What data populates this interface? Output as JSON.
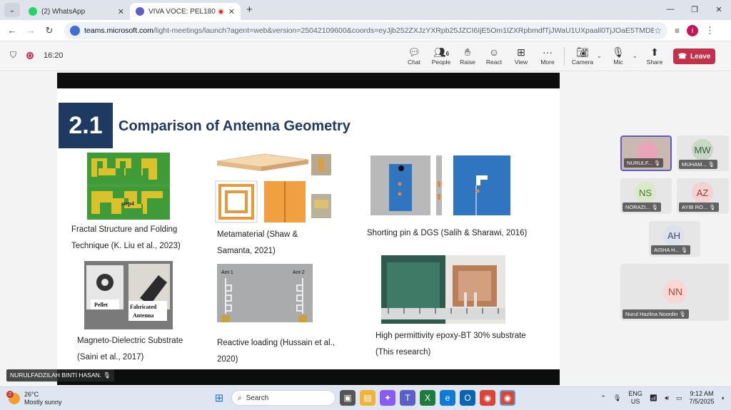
{
  "browser": {
    "tabs": [
      {
        "title": "(2) WhatsApp",
        "fav_color": "#25d366"
      },
      {
        "title": "VIVA VOCE: PEL18001-NUR",
        "fav_color": "#5b5fc7"
      }
    ],
    "url_host": "teams.microsoft.com",
    "url_path": "/light-meetings/launch?agent=web&version=25042109600&coords=eyJjb252ZXJzYXRpb25JZCI6IjE5Om1lZXRpbmdfTjJWaU1UXpaall0TjJOaE5TMDBZVFJtTFdFek9HVXRNalU...",
    "profile_initial": "I"
  },
  "meeting": {
    "time": "16:20",
    "toolbar": {
      "chat": "Chat",
      "people": "People",
      "people_count": "6",
      "raise": "Raise",
      "react": "React",
      "view": "View",
      "more": "More",
      "camera": "Camera",
      "mic": "Mic",
      "share": "Share",
      "leave": "Leave"
    },
    "presenter": "NURULFADZILAH BINTI HASAN."
  },
  "slide": {
    "section_number": "2.1",
    "title": "Comparison of Antenna Geometry",
    "figures": [
      {
        "caption_l1": "Fractal Structure and Folding",
        "caption_l2": "Technique (K. Liu et al., 2023)",
        "label": "step4"
      },
      {
        "caption_l1": "Metamaterial (Shaw &",
        "caption_l2": "Samanta, 2021)"
      },
      {
        "caption_l1": "Shorting pin & DGS (Salih & Sharawi, 2016)"
      },
      {
        "caption_l1": "Magneto-Dielectric Substrate",
        "caption_l2": "(Saini et al., 2017)",
        "label_a": "Pellet",
        "label_b1": "Fabricated",
        "label_b2": "Antenna"
      },
      {
        "caption_l1": "Reactive loading (Hussain et al.,",
        "caption_l2": "2020)",
        "label_a": "Ant-1",
        "label_b": "Ant-2"
      },
      {
        "caption_l1": "High permittivity epoxy-BT 30% substrate",
        "caption_l2": "(This research)"
      }
    ]
  },
  "participants": [
    {
      "name": "NURULF...",
      "initials": ""
    },
    {
      "name": "MUHAM...",
      "initials": "MW"
    },
    {
      "name": "NORAZI...",
      "initials": "NS"
    },
    {
      "name": "AYIB RO...",
      "initials": "AZ"
    },
    {
      "name": "AISHA H...",
      "initials": "AH"
    },
    {
      "name": "Nurul Hazlina Noordin",
      "initials": "NN"
    }
  ],
  "taskbar": {
    "temp": "26°C",
    "weather": "Mostly sunny",
    "badge": "2",
    "search": "Search",
    "lang1": "ENG",
    "lang2": "US",
    "clock": "9:12 AM",
    "date": "7/5/2025"
  }
}
